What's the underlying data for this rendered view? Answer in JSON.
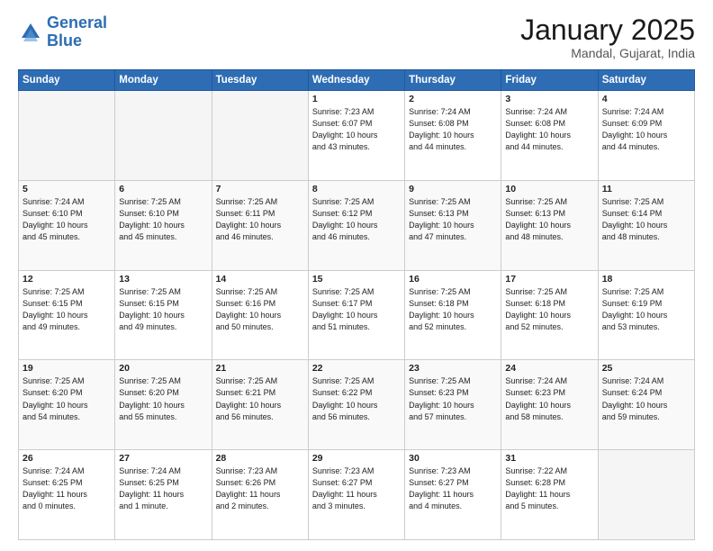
{
  "logo": {
    "line1": "General",
    "line2": "Blue"
  },
  "title": "January 2025",
  "subtitle": "Mandal, Gujarat, India",
  "days_header": [
    "Sunday",
    "Monday",
    "Tuesday",
    "Wednesday",
    "Thursday",
    "Friday",
    "Saturday"
  ],
  "weeks": [
    [
      {
        "num": "",
        "info": ""
      },
      {
        "num": "",
        "info": ""
      },
      {
        "num": "",
        "info": ""
      },
      {
        "num": "1",
        "info": "Sunrise: 7:23 AM\nSunset: 6:07 PM\nDaylight: 10 hours\nand 43 minutes."
      },
      {
        "num": "2",
        "info": "Sunrise: 7:24 AM\nSunset: 6:08 PM\nDaylight: 10 hours\nand 44 minutes."
      },
      {
        "num": "3",
        "info": "Sunrise: 7:24 AM\nSunset: 6:08 PM\nDaylight: 10 hours\nand 44 minutes."
      },
      {
        "num": "4",
        "info": "Sunrise: 7:24 AM\nSunset: 6:09 PM\nDaylight: 10 hours\nand 44 minutes."
      }
    ],
    [
      {
        "num": "5",
        "info": "Sunrise: 7:24 AM\nSunset: 6:10 PM\nDaylight: 10 hours\nand 45 minutes."
      },
      {
        "num": "6",
        "info": "Sunrise: 7:25 AM\nSunset: 6:10 PM\nDaylight: 10 hours\nand 45 minutes."
      },
      {
        "num": "7",
        "info": "Sunrise: 7:25 AM\nSunset: 6:11 PM\nDaylight: 10 hours\nand 46 minutes."
      },
      {
        "num": "8",
        "info": "Sunrise: 7:25 AM\nSunset: 6:12 PM\nDaylight: 10 hours\nand 46 minutes."
      },
      {
        "num": "9",
        "info": "Sunrise: 7:25 AM\nSunset: 6:13 PM\nDaylight: 10 hours\nand 47 minutes."
      },
      {
        "num": "10",
        "info": "Sunrise: 7:25 AM\nSunset: 6:13 PM\nDaylight: 10 hours\nand 48 minutes."
      },
      {
        "num": "11",
        "info": "Sunrise: 7:25 AM\nSunset: 6:14 PM\nDaylight: 10 hours\nand 48 minutes."
      }
    ],
    [
      {
        "num": "12",
        "info": "Sunrise: 7:25 AM\nSunset: 6:15 PM\nDaylight: 10 hours\nand 49 minutes."
      },
      {
        "num": "13",
        "info": "Sunrise: 7:25 AM\nSunset: 6:15 PM\nDaylight: 10 hours\nand 49 minutes."
      },
      {
        "num": "14",
        "info": "Sunrise: 7:25 AM\nSunset: 6:16 PM\nDaylight: 10 hours\nand 50 minutes."
      },
      {
        "num": "15",
        "info": "Sunrise: 7:25 AM\nSunset: 6:17 PM\nDaylight: 10 hours\nand 51 minutes."
      },
      {
        "num": "16",
        "info": "Sunrise: 7:25 AM\nSunset: 6:18 PM\nDaylight: 10 hours\nand 52 minutes."
      },
      {
        "num": "17",
        "info": "Sunrise: 7:25 AM\nSunset: 6:18 PM\nDaylight: 10 hours\nand 52 minutes."
      },
      {
        "num": "18",
        "info": "Sunrise: 7:25 AM\nSunset: 6:19 PM\nDaylight: 10 hours\nand 53 minutes."
      }
    ],
    [
      {
        "num": "19",
        "info": "Sunrise: 7:25 AM\nSunset: 6:20 PM\nDaylight: 10 hours\nand 54 minutes."
      },
      {
        "num": "20",
        "info": "Sunrise: 7:25 AM\nSunset: 6:20 PM\nDaylight: 10 hours\nand 55 minutes."
      },
      {
        "num": "21",
        "info": "Sunrise: 7:25 AM\nSunset: 6:21 PM\nDaylight: 10 hours\nand 56 minutes."
      },
      {
        "num": "22",
        "info": "Sunrise: 7:25 AM\nSunset: 6:22 PM\nDaylight: 10 hours\nand 56 minutes."
      },
      {
        "num": "23",
        "info": "Sunrise: 7:25 AM\nSunset: 6:23 PM\nDaylight: 10 hours\nand 57 minutes."
      },
      {
        "num": "24",
        "info": "Sunrise: 7:24 AM\nSunset: 6:23 PM\nDaylight: 10 hours\nand 58 minutes."
      },
      {
        "num": "25",
        "info": "Sunrise: 7:24 AM\nSunset: 6:24 PM\nDaylight: 10 hours\nand 59 minutes."
      }
    ],
    [
      {
        "num": "26",
        "info": "Sunrise: 7:24 AM\nSunset: 6:25 PM\nDaylight: 11 hours\nand 0 minutes."
      },
      {
        "num": "27",
        "info": "Sunrise: 7:24 AM\nSunset: 6:25 PM\nDaylight: 11 hours\nand 1 minute."
      },
      {
        "num": "28",
        "info": "Sunrise: 7:23 AM\nSunset: 6:26 PM\nDaylight: 11 hours\nand 2 minutes."
      },
      {
        "num": "29",
        "info": "Sunrise: 7:23 AM\nSunset: 6:27 PM\nDaylight: 11 hours\nand 3 minutes."
      },
      {
        "num": "30",
        "info": "Sunrise: 7:23 AM\nSunset: 6:27 PM\nDaylight: 11 hours\nand 4 minutes."
      },
      {
        "num": "31",
        "info": "Sunrise: 7:22 AM\nSunset: 6:28 PM\nDaylight: 11 hours\nand 5 minutes."
      },
      {
        "num": "",
        "info": ""
      }
    ]
  ]
}
